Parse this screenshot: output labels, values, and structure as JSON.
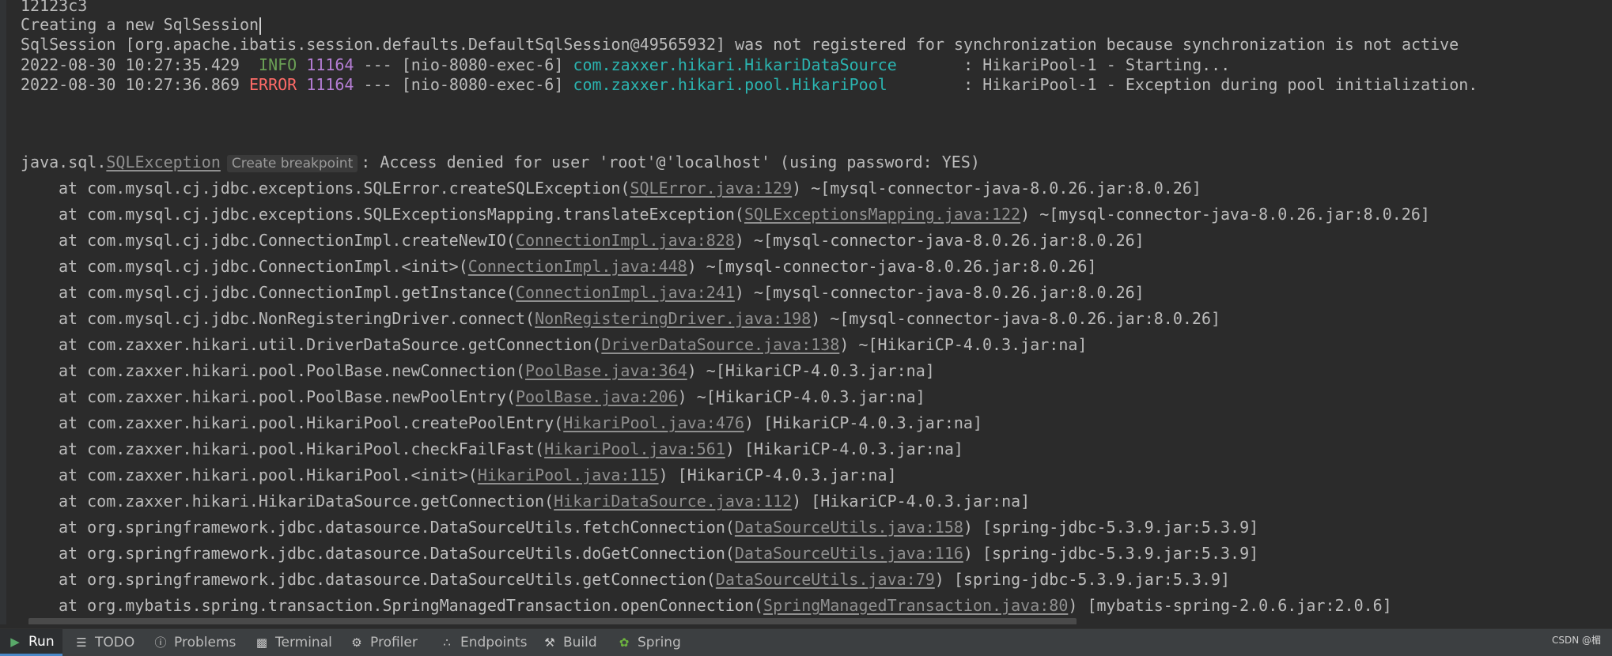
{
  "console": {
    "hash_line": "12123c3",
    "creating_line": "Creating a new SqlSession",
    "session_line": "SqlSession [org.apache.ibatis.session.defaults.DefaultSqlSession@49565932] was not registered for synchronization because synchronization is not active",
    "log_info": {
      "timestamp": "2022-08-30 10:27:35.429",
      "level": " INFO",
      "pid": "11164",
      "thread": " --- [nio-8080-exec-6] ",
      "logger": "com.zaxxer.hikari.HikariDataSource      ",
      "message": " : HikariPool-1 - Starting..."
    },
    "log_error": {
      "timestamp": "2022-08-30 10:27:36.869",
      "level": "ERROR",
      "pid": "11164",
      "thread": " --- [nio-8080-exec-6] ",
      "logger": "com.zaxxer.hikari.pool.HikariPool       ",
      "message": " : HikariPool-1 - Exception during pool initialization."
    },
    "exception": {
      "prefix": "java.sql.",
      "class_link": "SQLException",
      "breakpoint_label": "Create breakpoint",
      "message": ": Access denied for user 'root'@'localhost' (using password: YES)"
    },
    "stack": [
      {
        "method": "at com.mysql.cj.jdbc.exceptions.SQLError.createSQLException(",
        "file": "SQLError.java:129",
        "jar": ") ~[mysql-connector-java-8.0.26.jar:8.0.26]"
      },
      {
        "method": "at com.mysql.cj.jdbc.exceptions.SQLExceptionsMapping.translateException(",
        "file": "SQLExceptionsMapping.java:122",
        "jar": ") ~[mysql-connector-java-8.0.26.jar:8.0.26]"
      },
      {
        "method": "at com.mysql.cj.jdbc.ConnectionImpl.createNewIO(",
        "file": "ConnectionImpl.java:828",
        "jar": ") ~[mysql-connector-java-8.0.26.jar:8.0.26]"
      },
      {
        "method": "at com.mysql.cj.jdbc.ConnectionImpl.<init>(",
        "file": "ConnectionImpl.java:448",
        "jar": ") ~[mysql-connector-java-8.0.26.jar:8.0.26]"
      },
      {
        "method": "at com.mysql.cj.jdbc.ConnectionImpl.getInstance(",
        "file": "ConnectionImpl.java:241",
        "jar": ") ~[mysql-connector-java-8.0.26.jar:8.0.26]"
      },
      {
        "method": "at com.mysql.cj.jdbc.NonRegisteringDriver.connect(",
        "file": "NonRegisteringDriver.java:198",
        "jar": ") ~[mysql-connector-java-8.0.26.jar:8.0.26]"
      },
      {
        "method": "at com.zaxxer.hikari.util.DriverDataSource.getConnection(",
        "file": "DriverDataSource.java:138",
        "jar": ") ~[HikariCP-4.0.3.jar:na]"
      },
      {
        "method": "at com.zaxxer.hikari.pool.PoolBase.newConnection(",
        "file": "PoolBase.java:364",
        "jar": ") ~[HikariCP-4.0.3.jar:na]"
      },
      {
        "method": "at com.zaxxer.hikari.pool.PoolBase.newPoolEntry(",
        "file": "PoolBase.java:206",
        "jar": ") ~[HikariCP-4.0.3.jar:na]"
      },
      {
        "method": "at com.zaxxer.hikari.pool.HikariPool.createPoolEntry(",
        "file": "HikariPool.java:476",
        "jar": ") [HikariCP-4.0.3.jar:na]"
      },
      {
        "method": "at com.zaxxer.hikari.pool.HikariPool.checkFailFast(",
        "file": "HikariPool.java:561",
        "jar": ") [HikariCP-4.0.3.jar:na]"
      },
      {
        "method": "at com.zaxxer.hikari.pool.HikariPool.<init>(",
        "file": "HikariPool.java:115",
        "jar": ") [HikariCP-4.0.3.jar:na]"
      },
      {
        "method": "at com.zaxxer.hikari.HikariDataSource.getConnection(",
        "file": "HikariDataSource.java:112",
        "jar": ") [HikariCP-4.0.3.jar:na]"
      },
      {
        "method": "at org.springframework.jdbc.datasource.DataSourceUtils.fetchConnection(",
        "file": "DataSourceUtils.java:158",
        "jar": ") [spring-jdbc-5.3.9.jar:5.3.9]"
      },
      {
        "method": "at org.springframework.jdbc.datasource.DataSourceUtils.doGetConnection(",
        "file": "DataSourceUtils.java:116",
        "jar": ") [spring-jdbc-5.3.9.jar:5.3.9]"
      },
      {
        "method": "at org.springframework.jdbc.datasource.DataSourceUtils.getConnection(",
        "file": "DataSourceUtils.java:79",
        "jar": ") [spring-jdbc-5.3.9.jar:5.3.9]"
      },
      {
        "method": "at org.mybatis.spring.transaction.SpringManagedTransaction.openConnection(",
        "file": "SpringManagedTransaction.java:80",
        "jar": ") [mybatis-spring-2.0.6.jar:2.0.6]"
      }
    ]
  },
  "toolbar": {
    "run": "Run",
    "todo": "TODO",
    "problems": "Problems",
    "terminal": "Terminal",
    "profiler": "Profiler",
    "endpoints": "Endpoints",
    "build": "Build",
    "spring": "Spring"
  },
  "watermark": "CSDN @楣"
}
